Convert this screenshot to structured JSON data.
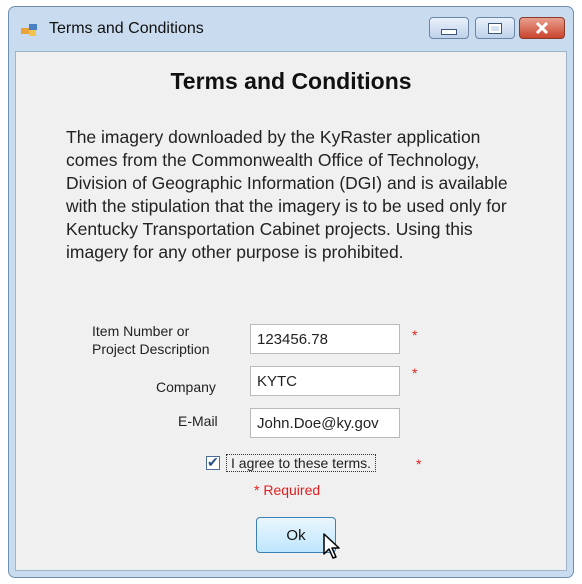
{
  "window": {
    "title": "Terms and Conditions",
    "controls": [
      "minimize-icon",
      "maximize-icon",
      "close-icon"
    ]
  },
  "dialog": {
    "heading": "Terms and Conditions",
    "body": "The imagery downloaded by the KyRaster application comes from the Commonwealth Office of Technology, Division of Geographic Information (DGI) and is available with the stipulation that the imagery is to be used only for Kentucky Transportation Cabinet projects. Using this imagery for any other purpose is prohibited."
  },
  "form": {
    "item_label_line1": "Item Number or",
    "item_label_line2": "Project Description",
    "item_value": "123456.78",
    "company_label": "Company",
    "company_value": "KYTC",
    "email_label": "E-Mail",
    "email_value": "John.Doe@ky.gov",
    "required_star": "*",
    "agree_label": "I agree to these terms.",
    "agree_checked": true,
    "required_note": "* Required"
  },
  "buttons": {
    "ok_label": "Ok"
  },
  "colors": {
    "required": "#e02020",
    "accent": "#3c7fb1"
  }
}
